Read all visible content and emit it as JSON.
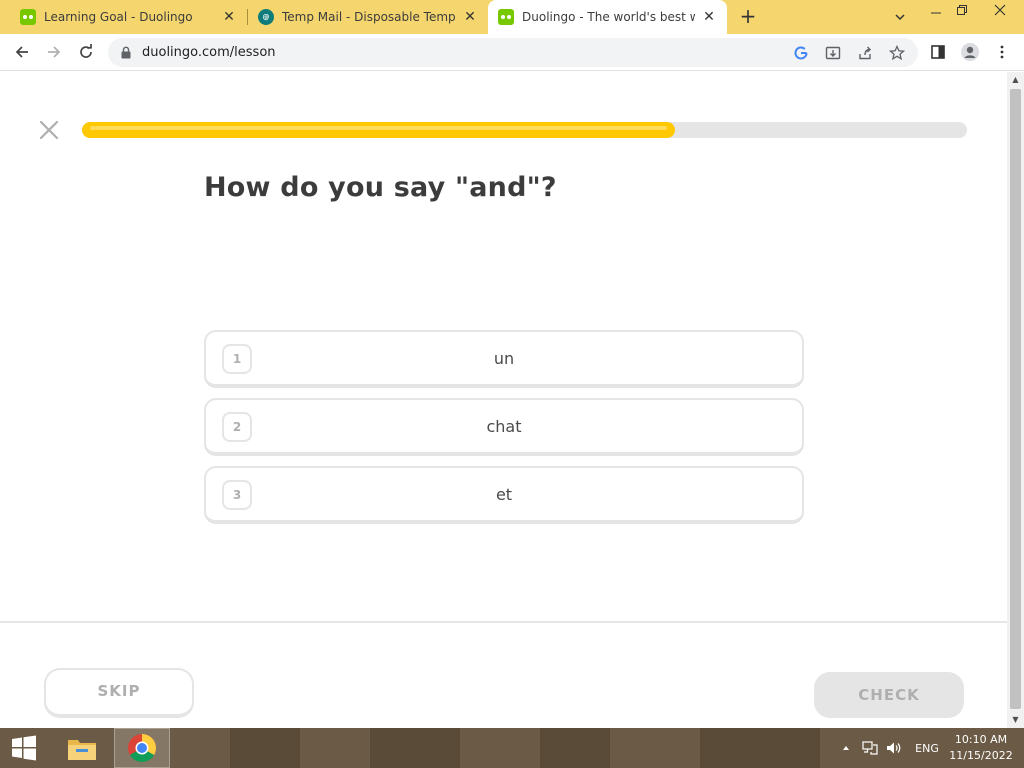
{
  "browser": {
    "tabs": [
      {
        "title": "Learning Goal - Duolingo",
        "favicon": "duolingo-icon",
        "active": false
      },
      {
        "title": "Temp Mail - Disposable Tempora",
        "favicon": "tempmail-icon",
        "active": false
      },
      {
        "title": "Duolingo - The world's best way",
        "favicon": "duolingo-icon",
        "active": true
      }
    ],
    "url": "duolingo.com/lesson",
    "tab_strip_color": "#f5d66e"
  },
  "lesson": {
    "progress": 0.67,
    "progress_color": "#ffc800",
    "question": "How do you say \"and\"?",
    "choices": [
      {
        "number": "1",
        "text": "un"
      },
      {
        "number": "2",
        "text": "chat"
      },
      {
        "number": "3",
        "text": "et"
      }
    ],
    "skip_label": "SKIP",
    "check_label": "CHECK"
  },
  "taskbar": {
    "language": "ENG",
    "time": "10:10 AM",
    "date": "11/15/2022"
  }
}
